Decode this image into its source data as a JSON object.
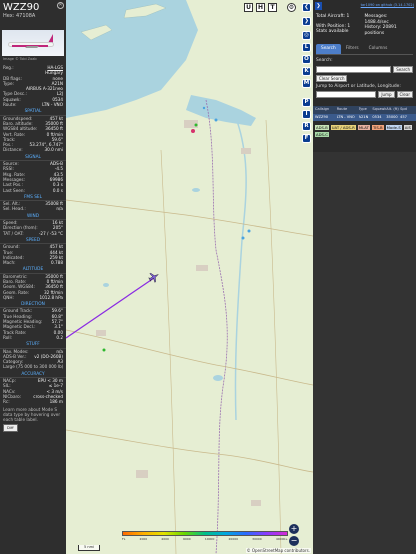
{
  "aircraft": {
    "callsign": "WZZ90",
    "hex": "Hex: 47108A",
    "photo_credit": "Image © Tobi Zoab"
  },
  "reg_rows": [
    {
      "k": "Reg.:",
      "v": "HA-LGS"
    },
    {
      "k": "",
      "v": "Hungary"
    },
    {
      "k": "DB flags:",
      "v": "none"
    },
    {
      "k": "Type:",
      "v": "A21N"
    },
    {
      "k": "",
      "v": "AIRBUS A-321neo"
    },
    {
      "k": "Type Desc.:",
      "v": "L2J"
    },
    {
      "k": "Squawk:",
      "v": "0534"
    },
    {
      "k": "Route:",
      "v": "LTN - VNO"
    }
  ],
  "sections": [
    {
      "title": "SPATIAL",
      "rows": [
        {
          "k": "Groundspeed:",
          "v": "457 kt"
        },
        {
          "k": "Baro. altitude:",
          "v": "35000 ft"
        },
        {
          "k": "WGS84 altitude:",
          "v": "36450 ft"
        },
        {
          "k": "Vert. Rate:",
          "v": "0 ft/min"
        },
        {
          "k": "Track:",
          "v": "59.6°"
        },
        {
          "k": "Pos.:",
          "v": "53.274°, 6.747°"
        },
        {
          "k": "Distance:",
          "v": "30.0 nmi"
        }
      ]
    },
    {
      "title": "SIGNAL",
      "rows": [
        {
          "k": "Source:",
          "v": "ADS-B"
        },
        {
          "k": "RSSI:",
          "v": "-4.5"
        },
        {
          "k": "Msg. Rate:",
          "v": "43.5"
        },
        {
          "k": "Messages:",
          "v": "69986"
        },
        {
          "k": "Last Pos.:",
          "v": "0.3 s"
        },
        {
          "k": "Last Seen:",
          "v": "0.0 s"
        }
      ]
    },
    {
      "title": "FMS SEL",
      "rows": [
        {
          "k": "Sel. Alt.:",
          "v": "35008 ft"
        },
        {
          "k": "Sel. Head.:",
          "v": "n/a"
        }
      ]
    },
    {
      "title": "WIND",
      "rows": [
        {
          "k": "Speed:",
          "v": "16 kt"
        },
        {
          "k": "Direction (from):",
          "v": "205°"
        },
        {
          "k": "TAT / OAT:",
          "v": "-27 / -53 °C"
        }
      ]
    },
    {
      "title": "SPEED",
      "rows": [
        {
          "k": "Ground:",
          "v": "457 kt"
        },
        {
          "k": "True:",
          "v": "444 kt"
        },
        {
          "k": "Indicated:",
          "v": "259 kt"
        },
        {
          "k": "Mach:",
          "v": "0.788"
        }
      ]
    },
    {
      "title": "ALTITUDE",
      "rows": [
        {
          "k": "Barometric:",
          "v": "35000 ft"
        },
        {
          "k": "Baro. Rate:",
          "v": "0 ft/min"
        },
        {
          "k": "Geom. WGS84:",
          "v": "36450 ft"
        },
        {
          "k": "Geom. Rate:",
          "v": "32 ft/min"
        },
        {
          "k": "QNH:",
          "v": "1012.8 hPa"
        }
      ]
    },
    {
      "title": "DIRECTION",
      "rows": [
        {
          "k": "Ground Track:",
          "v": "59.6°"
        },
        {
          "k": "True Heading:",
          "v": "60.8°"
        },
        {
          "k": "Magnetic Heading:",
          "v": "57.7°"
        },
        {
          "k": "Magnetic Decl.:",
          "v": "3.1°"
        },
        {
          "k": "Track Rate:",
          "v": "0.00"
        },
        {
          "k": "Roll:",
          "v": "0.2"
        }
      ]
    },
    {
      "title": "STUFF",
      "rows": [
        {
          "k": "Nav. Modes:",
          "v": "n/a"
        },
        {
          "k": "ADS-B Ver.:",
          "v": "v2 (DO-260B)"
        },
        {
          "k": "Category:",
          "v": "A3"
        },
        {
          "k": "Large (75 000 to 300 000 lb)",
          "v": ""
        }
      ]
    },
    {
      "title": "ACCURACY",
      "rows": [
        {
          "k": "NACp:",
          "v": "EPU < 30 m"
        },
        {
          "k": "SIL:",
          "v": "≤ 1e-7"
        },
        {
          "k": "NACv:",
          "v": "< 3 m/s"
        },
        {
          "k": "NICbaro:",
          "v": "cross-checked"
        },
        {
          "k": "Rc:",
          "v": "186 m"
        }
      ]
    }
  ],
  "footer": {
    "text": "Learn more about Mode S data type by hovering over each table label.",
    "button": "Diff"
  },
  "map": {
    "top_buttons": [
      "U",
      "H",
      "T"
    ],
    "layer_buttons": [
      "L",
      "O",
      "K",
      "M",
      "P",
      "I",
      "R",
      "F"
    ],
    "scale_label": "5 nmi",
    "altitude_labels": [
      "FL",
      "2000",
      "4000",
      "6000",
      "10000",
      "20000",
      "30000",
      "40000+"
    ],
    "attribution": "© OpenStreetMap contributors.",
    "zoom_in": "+",
    "zoom_out": "−"
  },
  "right": {
    "link": "tar1090 on github (3.14.1702)",
    "total_aircraft": "Total Aircraft: 1",
    "with_position": "With Position: 1",
    "stats": "Stats available",
    "messages": "Messages: 1488.4/sec",
    "history": "History: 20891 positions",
    "tabs": [
      "Search",
      "Filters",
      "Columns"
    ],
    "search_label": "Search:",
    "search_button": "Search",
    "clear_search": "Clear Search",
    "jump_label": "Jump to Airport or Latitude, Longitude:",
    "jump_button": "Jump",
    "clear_button": "Clear",
    "table_headers": [
      "Callsign",
      "Route",
      "Type",
      "Squawk",
      "Alt. (ft)",
      "Spd"
    ],
    "table_row": [
      "WZZ90",
      "LTN - VNO",
      "A21N",
      "0534",
      "35000",
      "457"
    ],
    "badges": [
      {
        "label": "ADS-B",
        "color": "#c7e3b8"
      },
      {
        "label": "UAT / ADS-R",
        "color": "#e8d27a"
      },
      {
        "label": "MLAT",
        "color": "#e8b0a0"
      },
      {
        "label": "TIS-B",
        "color": "#f2a37a"
      },
      {
        "label": "Mode-S",
        "color": "#bfd4ee"
      },
      {
        "label": "AIS",
        "color": "#d7d7d7"
      },
      {
        "label": "ADS-C",
        "color": "#a8d8a8"
      }
    ]
  },
  "colors": {
    "accent": "#5bb0ff",
    "map_land": "#e6eed3",
    "water": "#aad3df",
    "track": "#8a2be2"
  }
}
